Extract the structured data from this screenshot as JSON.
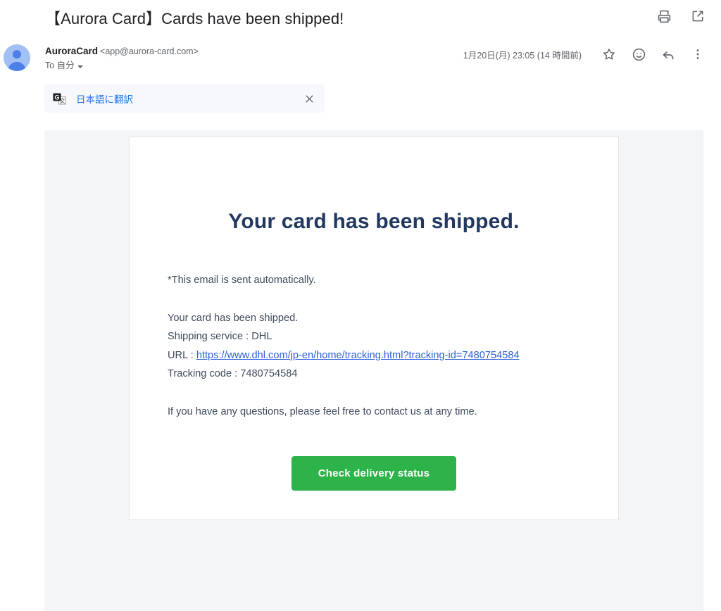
{
  "header": {
    "subject": "【Aurora Card】Cards have been shipped!",
    "actions": [
      {
        "name": "print-icon",
        "label": "Print"
      },
      {
        "name": "open-in-new-window-icon",
        "label": "Open in new window"
      }
    ]
  },
  "message_meta": {
    "sender_name": "AuroraCard",
    "sender_email": "<app@aurora-card.com>",
    "recipient": "To 自分",
    "date": "1月20日(月) 23:05 (14 時間前)",
    "actions": [
      {
        "name": "star-icon",
        "label": "スターを付ける"
      },
      {
        "name": "add-reaction-icon",
        "label": "リアクションを追加"
      },
      {
        "name": "reply-icon",
        "label": "返信"
      },
      {
        "name": "more-options-icon",
        "label": "その他"
      }
    ]
  },
  "translate_bar": {
    "icon": "google-translate-icon",
    "link_label": "日本語に翻訳",
    "close_label": "×",
    "background_color": "#f6f8fc",
    "link_color": "#1a73e8"
  },
  "email_body": {
    "heading": "Your card has been shipped.",
    "heading_color": "#22385f",
    "note": "*This email is sent automatically.",
    "line_shipped": "Your card has been shipped.",
    "line_service": "Shipping service : DHL",
    "url_prefix": "URL : ",
    "tracking_url": "https://www.dhl.com/jp-en/home/tracking.html?tracking-id=7480754584",
    "line_tracking_code": "Tracking code : 7480754584",
    "line_contact": "If you have any questions, please feel free to contact us at any time.",
    "cta_label": "Check delivery status",
    "cta_color": "#2eb34a",
    "link_color": "#2b5fd9",
    "text_color": "#3f4a5c"
  }
}
